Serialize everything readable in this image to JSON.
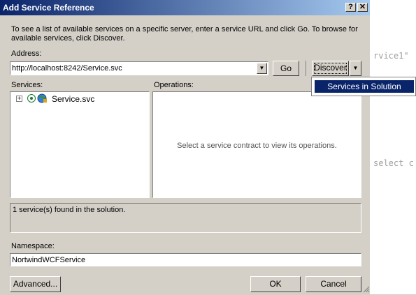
{
  "dialog": {
    "title": "Add Service Reference",
    "help_label": "?",
    "close_label": "✕",
    "instructions": "To see a list of available services on a specific server, enter a service URL and click Go. To browse for available services, click Discover.",
    "address_label": "Address:",
    "address_value": "http://localhost:8242/Service.svc",
    "go_label": "Go",
    "discover_label": "Discover",
    "discover_menu_item": "Services in Solution",
    "services_label": "Services:",
    "operations_label": "Operations:",
    "tree_expand": "+",
    "service_item": "Service.svc",
    "operations_placeholder": "Select a service contract to view its operations.",
    "status_text": "1 service(s) found in the solution.",
    "namespace_label": "Namespace:",
    "namespace_value": "NortwindWCFService",
    "advanced_label": "Advanced...",
    "ok_label": "OK",
    "cancel_label": "Cancel"
  },
  "background_code": {
    "line1": "rvice1\"",
    "line2": "select c"
  }
}
